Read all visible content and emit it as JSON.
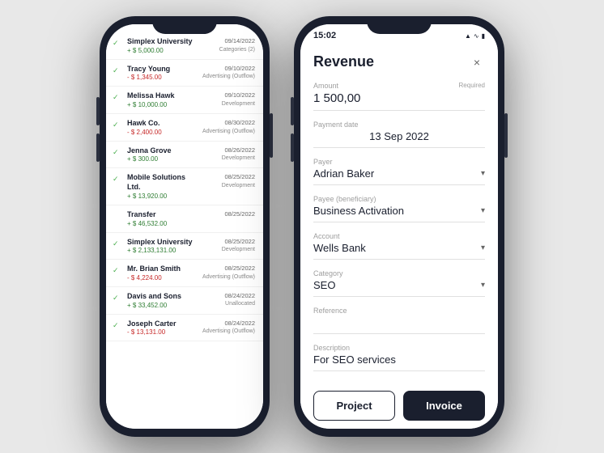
{
  "left_phone": {
    "transactions": [
      {
        "name": "Simplex University",
        "amount": "+ $ 5,000.00",
        "positive": true,
        "date": "09/14/2022",
        "category": "Categories (2)",
        "checked": true
      },
      {
        "name": "Tracy Young",
        "amount": "- $ 1,345.00",
        "positive": false,
        "date": "09/10/2022",
        "category": "Advertising (Outflow)",
        "checked": true
      },
      {
        "name": "Melissa Hawk",
        "amount": "+ $ 10,000.00",
        "positive": true,
        "date": "09/10/2022",
        "category": "Development",
        "checked": true
      },
      {
        "name": "Hawk Co.",
        "amount": "- $ 2,400.00",
        "positive": false,
        "date": "08/30/2022",
        "category": "Advertising (Outflow)",
        "checked": true
      },
      {
        "name": "Jenna Grove",
        "amount": "+ $ 300.00",
        "positive": true,
        "date": "08/26/2022",
        "category": "Development",
        "checked": true
      },
      {
        "name": "Mobile Solutions Ltd.",
        "amount": "+ $ 13,920.00",
        "positive": true,
        "date": "08/25/2022",
        "category": "Development",
        "checked": true
      },
      {
        "name": "Transfer",
        "amount": "+ $ 46,532.00",
        "positive": true,
        "date": "08/25/2022",
        "category": "",
        "checked": false
      },
      {
        "name": "Simplex University",
        "amount": "+ $ 2,133,131.00",
        "positive": true,
        "date": "08/25/2022",
        "category": "Development",
        "checked": true
      },
      {
        "name": "Mr. Brian Smith",
        "amount": "- $ 4,224.00",
        "positive": false,
        "date": "08/25/2022",
        "category": "Advertising (Outflow)",
        "checked": true
      },
      {
        "name": "Davis and Sons",
        "amount": "+ $ 33,452.00",
        "positive": true,
        "date": "08/24/2022",
        "category": "Unallocated",
        "checked": true
      },
      {
        "name": "Joseph Carter",
        "amount": "- $ 13,131.00",
        "positive": false,
        "date": "08/24/2022",
        "category": "Advertising (Outflow)",
        "checked": true
      }
    ]
  },
  "right_phone": {
    "status_bar": {
      "time": "15:02",
      "icons": [
        "signal",
        "wifi",
        "battery"
      ]
    },
    "form": {
      "title": "Revenue",
      "close_label": "×",
      "fields": {
        "amount_label": "Amount",
        "amount_value": "1 500,00",
        "amount_required": "Required",
        "payment_date_label": "Payment date",
        "payment_date_value": "13 Sep 2022",
        "payer_label": "Payer",
        "payer_value": "Adrian Baker",
        "payee_label": "Payee (beneficiary)",
        "payee_value": "Business Activation",
        "account_label": "Account",
        "account_value": "Wells Bank",
        "category_label": "Category",
        "category_value": "SEO",
        "reference_label": "Reference",
        "reference_placeholder": "",
        "description_label": "Description",
        "description_value": "For SEO services"
      },
      "buttons": {
        "project_label": "Project",
        "invoice_label": "Invoice"
      }
    }
  }
}
